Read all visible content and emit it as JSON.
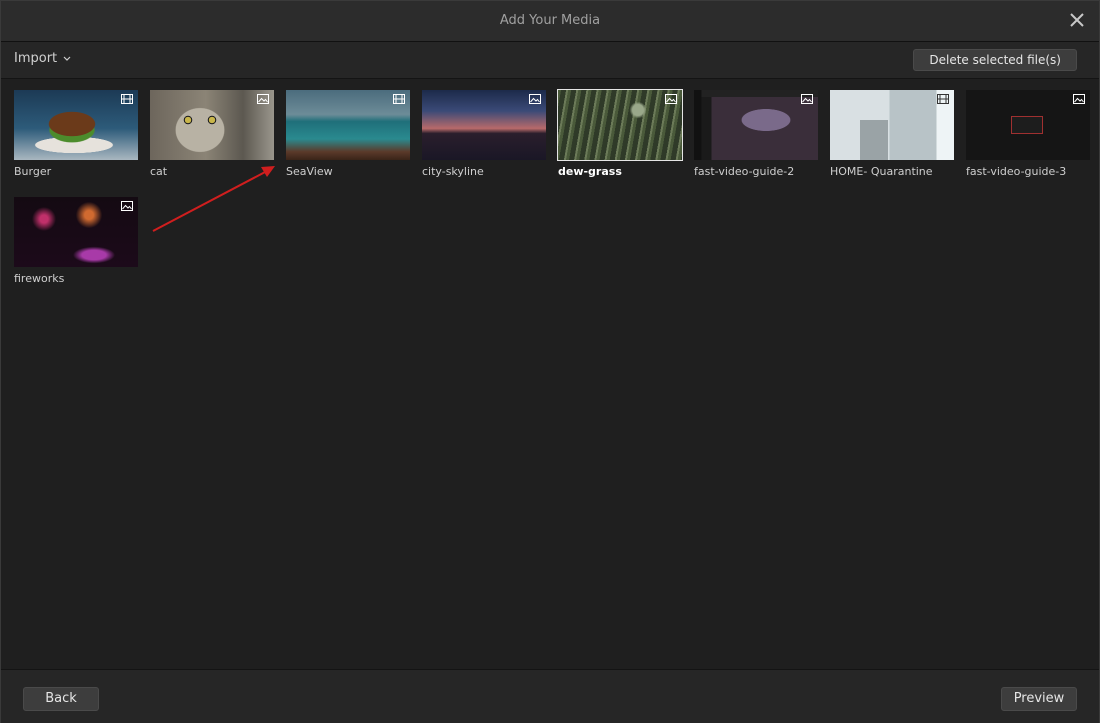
{
  "window": {
    "title": "Add Your Media"
  },
  "toolbar": {
    "import_label": "Import",
    "delete_label": "Delete selected file(s)"
  },
  "media": [
    {
      "name": "Burger",
      "type": "video",
      "selected": false
    },
    {
      "name": "cat",
      "type": "image",
      "selected": false
    },
    {
      "name": "SeaView",
      "type": "video",
      "selected": false
    },
    {
      "name": "city-skyline",
      "type": "image",
      "selected": false
    },
    {
      "name": "dew-grass",
      "type": "image",
      "selected": true
    },
    {
      "name": "fast-video-guide-2",
      "type": "image",
      "selected": false
    },
    {
      "name": "HOME- Quarantine",
      "type": "video",
      "selected": false
    },
    {
      "name": "fast-video-guide-3",
      "type": "image",
      "selected": false
    },
    {
      "name": "fireworks",
      "type": "image",
      "selected": false
    }
  ],
  "footer": {
    "back_label": "Back",
    "preview_label": "Preview"
  },
  "colors": {
    "background": "#1f1f1f",
    "annotation_arrow": "#d01e1e",
    "selection_border": "#e6e6e6"
  },
  "icons": {
    "close": "close-icon",
    "import_menu": "chevron-down-icon",
    "video_badge": "film-icon",
    "image_badge": "image-icon"
  }
}
